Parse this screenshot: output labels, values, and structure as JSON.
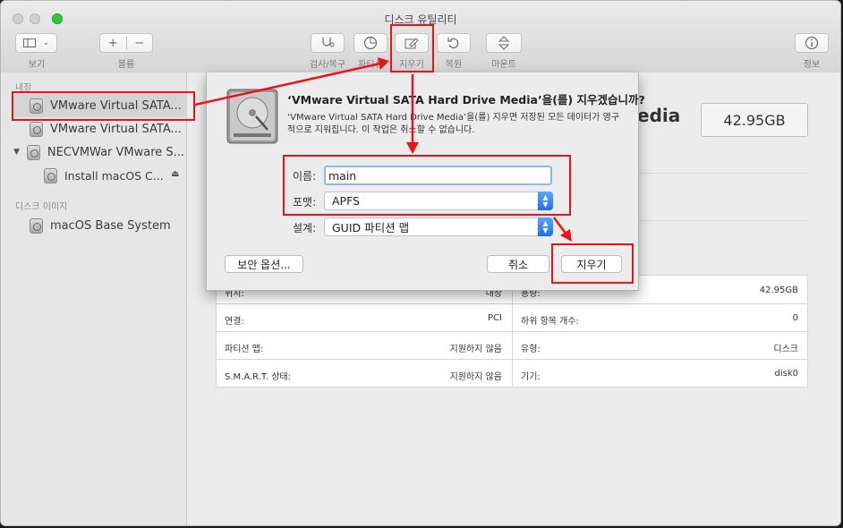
{
  "window": {
    "title": "디스크 유틸리티"
  },
  "toolbar": {
    "view_label": "보기",
    "volume_label": "볼륨",
    "plus": "+",
    "minus": "−",
    "firstaid_label": "검사/복구",
    "partition_label": "파티션",
    "erase_label": "지우기",
    "restore_label": "복원",
    "mount_label": "마운트",
    "info_label": "정보"
  },
  "sidebar": {
    "internal_header": "내장",
    "items": [
      {
        "label": "VMware Virtual SATA..."
      },
      {
        "label": "VMware Virtual SATA..."
      },
      {
        "label": "NECVMWar VMware S..."
      },
      {
        "label": "Install macOS C..."
      }
    ],
    "images_header": "디스크 이미지",
    "image_items": [
      {
        "label": "macOS Base System"
      }
    ]
  },
  "main": {
    "title_fragment": "edia",
    "size": "42.95GB",
    "info": {
      "left": [
        {
          "label": "위치:",
          "value": "내장"
        },
        {
          "label": "연결:",
          "value": "PCI"
        },
        {
          "label": "파티션 맵:",
          "value": "지원하지 않음"
        },
        {
          "label": "S.M.A.R.T. 상태:",
          "value": "지원하지 않음"
        }
      ],
      "right": [
        {
          "label": "용량:",
          "value": "42.95GB"
        },
        {
          "label": "하위 항목 개수:",
          "value": "0"
        },
        {
          "label": "유형:",
          "value": "디스크"
        },
        {
          "label": "기기:",
          "value": "disk0"
        }
      ]
    }
  },
  "dialog": {
    "title": "‘VMware Virtual SATA Hard Drive Media’을(를) 지우겠습니까?",
    "message": "‘VMware Virtual SATA Hard Drive Media’을(를) 지우면 저장된 모든 데이터가 영구적으로 지워집니다. 이 작업은 취소할 수 없습니다.",
    "name_label": "이름:",
    "name_value": "main",
    "format_label": "포맷:",
    "format_value": "APFS",
    "scheme_label": "설계:",
    "scheme_value": "GUID 파티션 맵",
    "security_button": "보안 옵션...",
    "cancel_button": "취소",
    "erase_button": "지우기"
  },
  "annotation_color": "#e8141c"
}
